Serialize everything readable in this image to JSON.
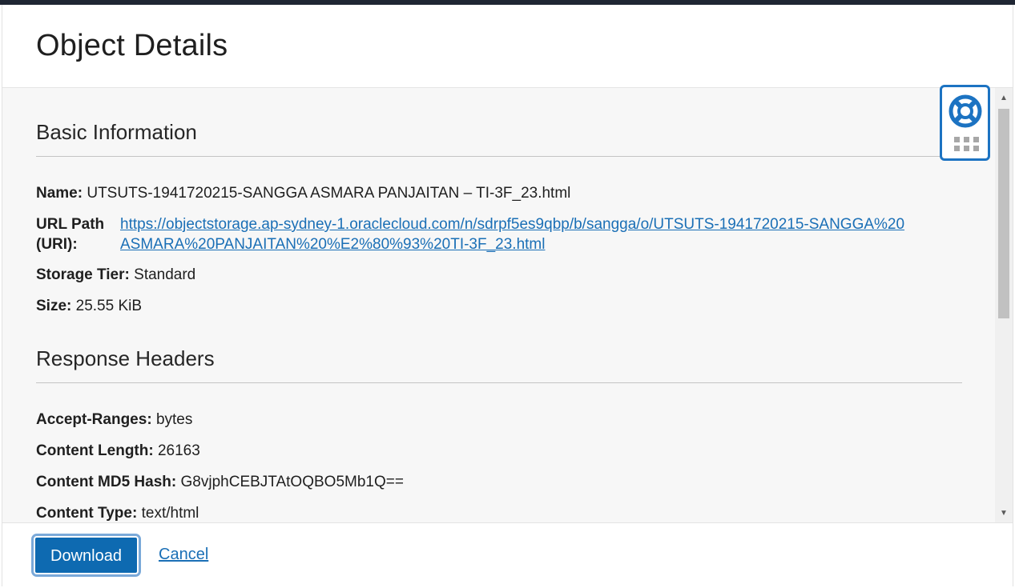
{
  "dialog": {
    "title": "Object Details"
  },
  "basic_info": {
    "heading": "Basic Information",
    "name_label": "Name:",
    "name_value": "UTSUTS-1941720215-SANGGA ASMARA PANJAITAN – TI-3F_23.html",
    "url_label": "URL Path (URI):",
    "url_value": "https://objectstorage.ap-sydney-1.oraclecloud.com/n/sdrpf5es9qbp/b/sangga/o/UTSUTS-1941720215-SANGGA%20ASMARA%20PANJAITAN%20%E2%80%93%20TI-3F_23.html",
    "tier_label": "Storage Tier:",
    "tier_value": "Standard",
    "size_label": "Size:",
    "size_value": "25.55 KiB"
  },
  "response_headers": {
    "heading": "Response Headers",
    "accept_ranges_label": "Accept-Ranges:",
    "accept_ranges_value": "bytes",
    "content_length_label": "Content Length:",
    "content_length_value": "26163",
    "md5_label": "Content MD5 Hash:",
    "md5_value": "G8vjphCEBJTAtOQBO5Mb1Q==",
    "content_type_label": "Content Type:",
    "content_type_value": "text/html"
  },
  "footer": {
    "download_label": "Download",
    "cancel_label": "Cancel"
  },
  "help_widget": {
    "icon": "lifebuoy-icon",
    "grid_icon": "apps-grid-icon"
  },
  "colors": {
    "accent": "#0e6ab1",
    "link": "#1a6fb6",
    "help_border": "#1c73c2"
  }
}
